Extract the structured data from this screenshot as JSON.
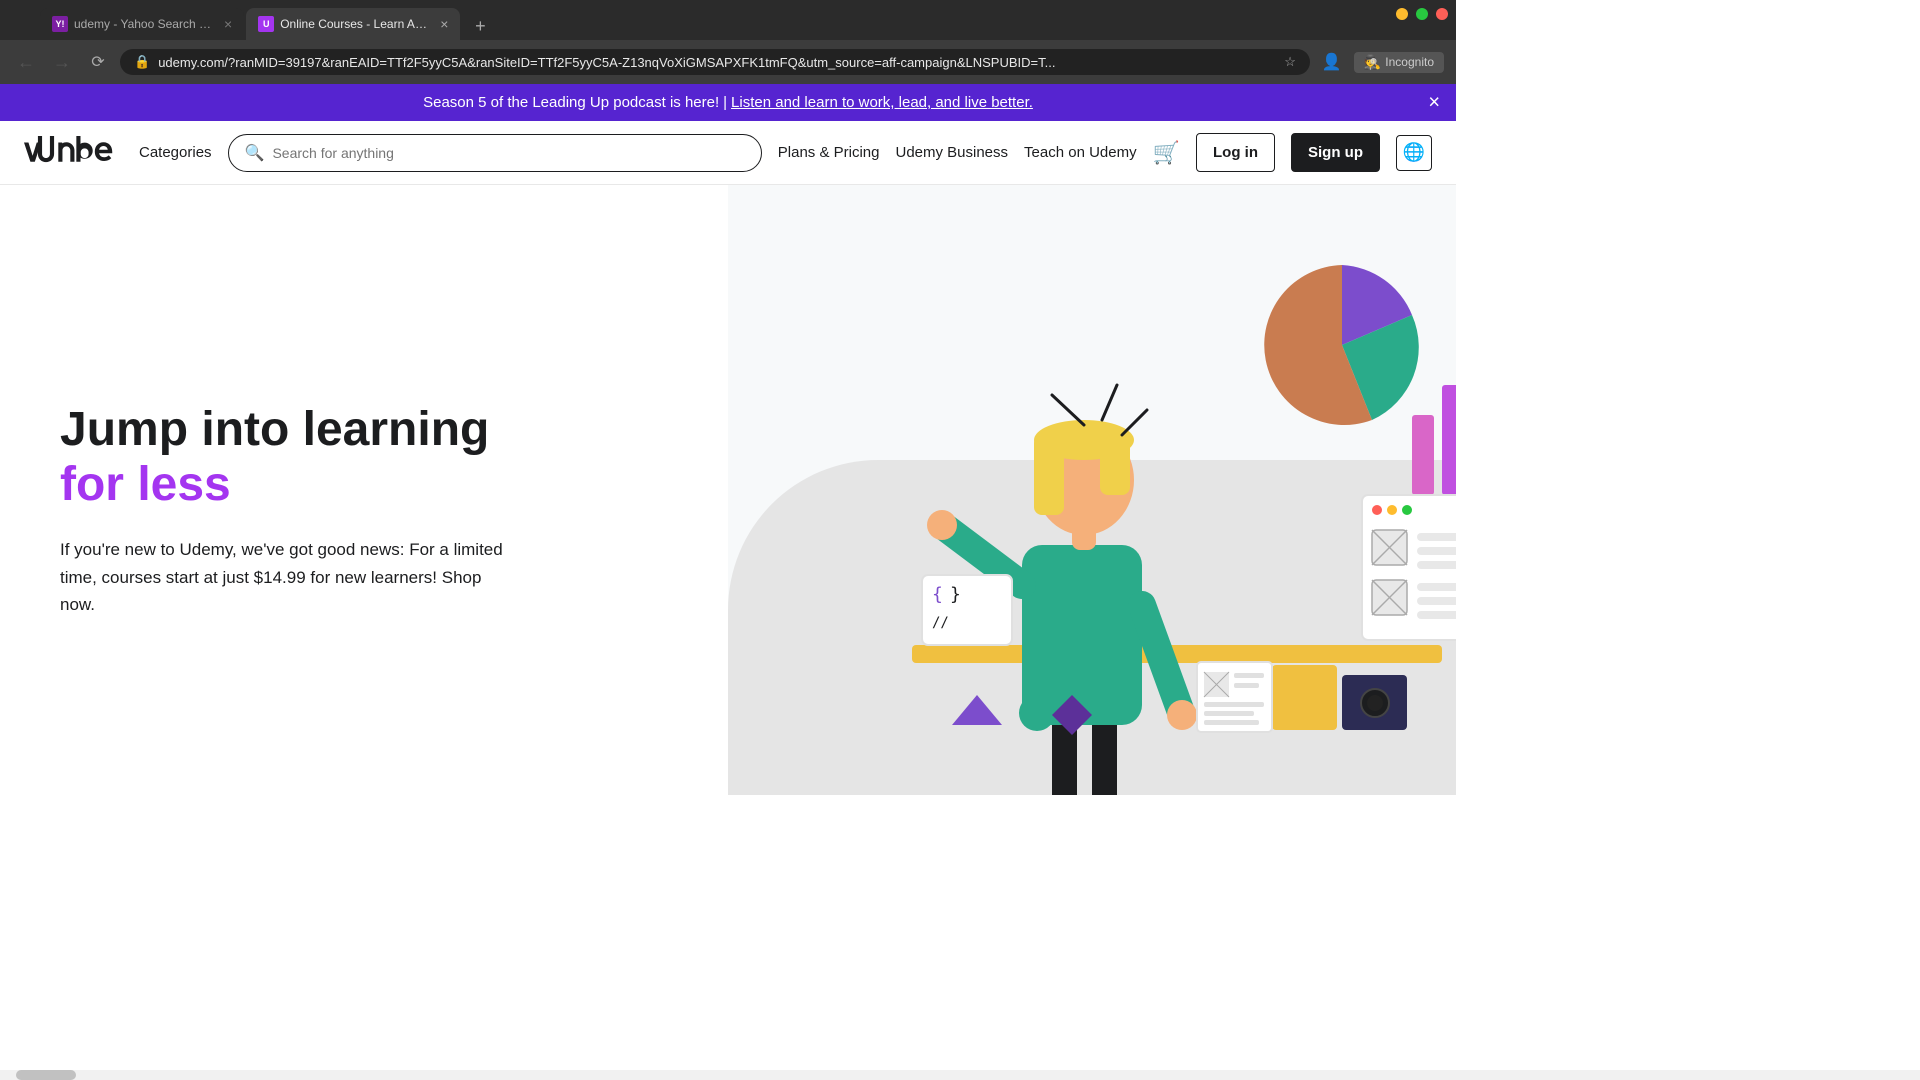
{
  "browser": {
    "tabs": [
      {
        "id": "tab1",
        "favicon_label": "Y!",
        "title": "udemy - Yahoo Search Results",
        "active": false
      },
      {
        "id": "tab2",
        "favicon_label": "U",
        "title": "Online Courses - Learn Anythin...",
        "active": true
      }
    ],
    "new_tab_label": "+",
    "address": "udemy.com/?ranMID=39197&ranEAID=TTf2F5yyC5A&ranSiteID=TTf2F5yyC5A-Z13nqVoXiGMSAPXFK1tmFQ&utm_source=aff-campaign&LNSPUBID=T...",
    "incognito_label": "Incognito",
    "window_controls": {
      "close": "×",
      "minimize": "−",
      "maximize": "□"
    }
  },
  "banner": {
    "text_before": "Season 5 of the Leading Up podcast is here!",
    "separator": " | ",
    "link_text": "Listen and learn to work, lead, and live better.",
    "close_label": "×"
  },
  "navbar": {
    "logo_text": "udemy",
    "categories_label": "Categories",
    "search_placeholder": "Search for anything",
    "plans_pricing_label": "Plans & Pricing",
    "udemy_business_label": "Udemy Business",
    "teach_label": "Teach on Udemy",
    "login_label": "Log in",
    "signup_label": "Sign up"
  },
  "hero": {
    "heading_line1": "Jump into learning",
    "heading_accent": "for less",
    "subtext": "If you're new to Udemy, we've got good news: For a limited time, courses start at just $14.99 for new learners! Shop now.",
    "accent_color": "#a435f0"
  }
}
